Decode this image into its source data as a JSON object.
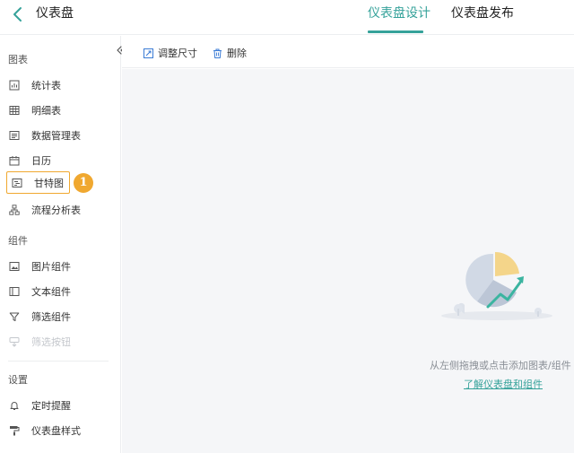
{
  "header": {
    "title": "仪表盘",
    "tabs": [
      {
        "label": "仪表盘设计",
        "active": true
      },
      {
        "label": "仪表盘发布",
        "active": false
      }
    ]
  },
  "sidebar": {
    "sections": [
      {
        "title": "图表",
        "items": [
          {
            "label": "统计表",
            "icon": "stat-table-icon"
          },
          {
            "label": "明细表",
            "icon": "grid-table-icon"
          },
          {
            "label": "数据管理表",
            "icon": "data-table-icon"
          },
          {
            "label": "日历",
            "icon": "calendar-icon"
          },
          {
            "label": "甘特图",
            "icon": "gantt-icon",
            "active": true
          },
          {
            "label": "流程分析表",
            "icon": "flow-icon"
          }
        ]
      },
      {
        "title": "组件",
        "items": [
          {
            "label": "图片组件",
            "icon": "image-icon"
          },
          {
            "label": "文本组件",
            "icon": "text-icon"
          },
          {
            "label": "筛选组件",
            "icon": "filter-icon"
          },
          {
            "label": "筛选按钮",
            "icon": "filter-button-icon",
            "disabled": true
          }
        ]
      },
      {
        "title": "设置",
        "items": [
          {
            "label": "定时提醒",
            "icon": "bell-icon"
          },
          {
            "label": "仪表盘样式",
            "icon": "paint-roller-icon"
          }
        ]
      }
    ],
    "step_badge": "1"
  },
  "toolbar": {
    "resize_label": "调整尺寸",
    "delete_label": "删除"
  },
  "canvas": {
    "empty_text": "从左侧拖拽或点击添加图表/组件",
    "link_text": "了解仪表盘和组件"
  },
  "colors": {
    "accent": "#35a29a",
    "highlight": "#f0a830",
    "canvas_bg": "#f5f6f8"
  }
}
